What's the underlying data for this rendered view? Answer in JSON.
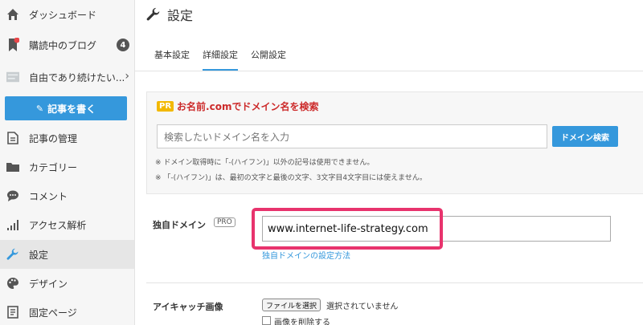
{
  "sidebar": {
    "items": [
      {
        "label": "ダッシュボード",
        "icon": "home-icon"
      },
      {
        "label": "購読中のブログ",
        "icon": "bookmark-icon",
        "badge": "4"
      },
      {
        "label": "自由であり続けたい...",
        "icon": "blog-thumbnail-icon"
      },
      {
        "label": "記事の管理",
        "icon": "document-icon"
      },
      {
        "label": "カテゴリー",
        "icon": "folder-icon"
      },
      {
        "label": "コメント",
        "icon": "comment-icon"
      },
      {
        "label": "アクセス解析",
        "icon": "bar-chart-icon"
      },
      {
        "label": "設定",
        "icon": "wrench-icon"
      },
      {
        "label": "デザイン",
        "icon": "palette-icon"
      },
      {
        "label": "固定ページ",
        "icon": "page-icon"
      }
    ],
    "write_button": "記事を書く"
  },
  "main": {
    "title": "設定",
    "tabs": [
      {
        "label": "基本設定"
      },
      {
        "label": "詳細設定"
      },
      {
        "label": "公開設定"
      }
    ],
    "pr": {
      "tag": "PR",
      "title": "お名前.comでドメイン名を検索",
      "placeholder": "検索したいドメイン名を入力",
      "button": "ドメイン検索",
      "note1": "ドメイン取得時に「-(ハイフン)」以外の記号は使用できません。",
      "note2": "「-(ハイフン)」は、最初の文字と最後の文字、3文字目4文字目には使えません。"
    },
    "domain": {
      "label": "独自ドメイン",
      "tag": "PRO",
      "value": "www.internet-life-strategy.com",
      "link": "独自ドメインの設定方法"
    },
    "eyecatch": {
      "label": "アイキャッチ画像",
      "file_button": "ファイルを選択",
      "file_status": "選択されていません",
      "delete_label": "画像を削除する"
    }
  },
  "colors": {
    "accent": "#3598dc",
    "highlight": "#e8336d",
    "pr_red": "#cc2a2a",
    "pr_yellow": "#f2b800",
    "notification": "#e8474a"
  }
}
